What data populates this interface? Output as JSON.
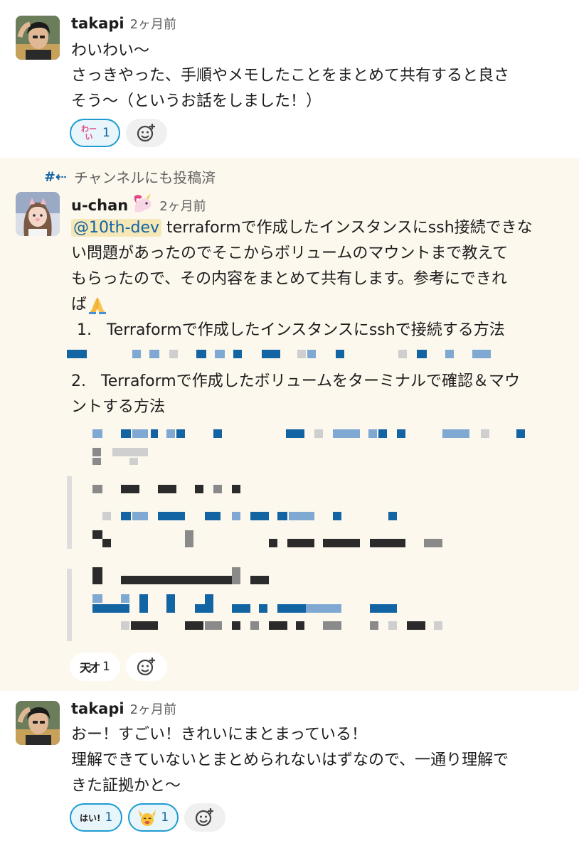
{
  "messages": [
    {
      "user": "takapi",
      "time": "2ヶ月前",
      "lines": [
        "わいわい〜",
        "さっきやった、手順やメモしたことをまとめて共有すると良さ",
        "そう〜（というお話をしました！）"
      ],
      "reactions": [
        {
          "emoji_label": "わーい",
          "emoji": "wai-emoji",
          "count": "1",
          "mine": true
        }
      ]
    },
    {
      "context": "チャンネルにも投稿済",
      "context_icon": "hash-arrow-icon",
      "user": "u-chan",
      "user_badge": "unicorn-emoji",
      "time": "2ヶ月前",
      "mention": "@10th-dev",
      "lines": [
        "terraformで作成したインスタンスにssh接続できな",
        "い問題があったのでそこからボリュームのマウントまで教えて",
        "もらったので、その内容をまとめて共有します。参考にできれ",
        "ば"
      ],
      "list": [
        {
          "num": "1.",
          "text": "Terraformで作成したインスタンスにsshで接続する方法"
        },
        {
          "num": "2.",
          "text": "Terraformで作成したボリュームをターミナルで確認＆マウ",
          "cont": "ントする方法"
        }
      ],
      "reactions": [
        {
          "emoji_label": "天才",
          "emoji": "tensai-emoji",
          "count": "1",
          "mine": false
        }
      ]
    },
    {
      "user": "takapi",
      "time": "2ヶ月前",
      "lines": [
        "おー！すごい！きれいにまとまっている！",
        "理解できていないとまとめられないはずなので、一通り理解で",
        "きた証拠かと〜"
      ],
      "reactions": [
        {
          "emoji_label": "はい!",
          "emoji": "hai-emoji",
          "count": "1",
          "mine": true
        },
        {
          "emoji_label": "",
          "emoji": "banzai-emoji",
          "count": "1",
          "mine": true
        }
      ]
    }
  ],
  "colors": {
    "highlight_bg": "#fcf8ed",
    "link": "#1264a3",
    "mention_bg": "#f6e7b7",
    "reaction_border": "#1d9bd1"
  }
}
